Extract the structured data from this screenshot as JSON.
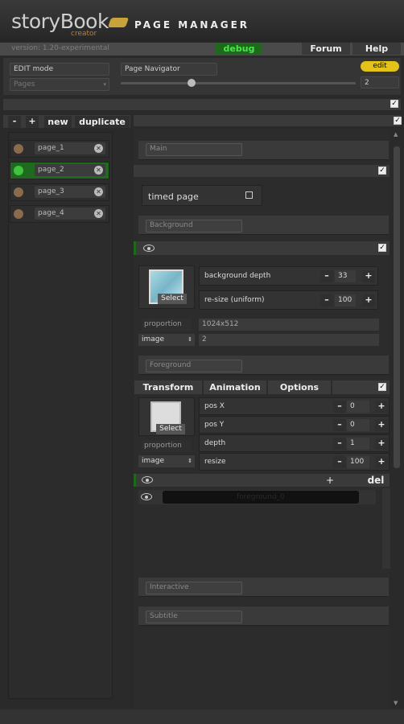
{
  "header": {
    "logo": "storyBook",
    "logo_sub": "creator",
    "title": "PAGE MANAGER"
  },
  "topbar": {
    "version": "version: 1.20-experimental",
    "debug": "debug",
    "forum": "Forum",
    "help": "Help"
  },
  "controls": {
    "mode": "EDIT mode",
    "mode_select": "Pages",
    "navigator": "Page Navigator",
    "edit_button": "edit",
    "page_number": "2",
    "nav_slider_fraction": 0.3
  },
  "pages_toolbar": {
    "minus": "-",
    "plus": "+",
    "new": "new",
    "duplicate": "duplicate"
  },
  "pages": [
    {
      "name": "page_1",
      "active": false
    },
    {
      "name": "page_2",
      "active": true
    },
    {
      "name": "page_3",
      "active": false
    },
    {
      "name": "page_4",
      "active": false
    }
  ],
  "main": {
    "section_main": "Main",
    "timed_page": "timed page",
    "section_background": "Background",
    "bg_depth_label": "background depth",
    "bg_depth_value": "33",
    "bg_resize_label": "re-size (uniform)",
    "bg_resize_value": "100",
    "select": "Select",
    "proportion_label": "proportion",
    "proportion_value": "1024x512",
    "image_label": "image",
    "image_value": "2",
    "section_foreground": "Foreground",
    "tabs": [
      "Transform",
      "Animation",
      "Options"
    ],
    "fg_posx_label": "pos X",
    "fg_posx_value": "0",
    "fg_posy_label": "pos Y",
    "fg_posy_value": "0",
    "fg_depth_label": "depth",
    "fg_depth_value": "1",
    "fg_resize_label": "resize",
    "fg_resize_value": "100",
    "fg_select": "Select",
    "fg_proportion_label": "proportion",
    "fg_image_label": "image",
    "layers_plus": "+",
    "layers_del": "del",
    "layer_name": "foreground_0",
    "section_interactive": "Interactive",
    "section_subtitle": "Subtitle"
  },
  "colors": {
    "accent_green": "#1d6a1d",
    "edit_yellow": "#e3c21a",
    "debug_text": "#4ee24e"
  }
}
